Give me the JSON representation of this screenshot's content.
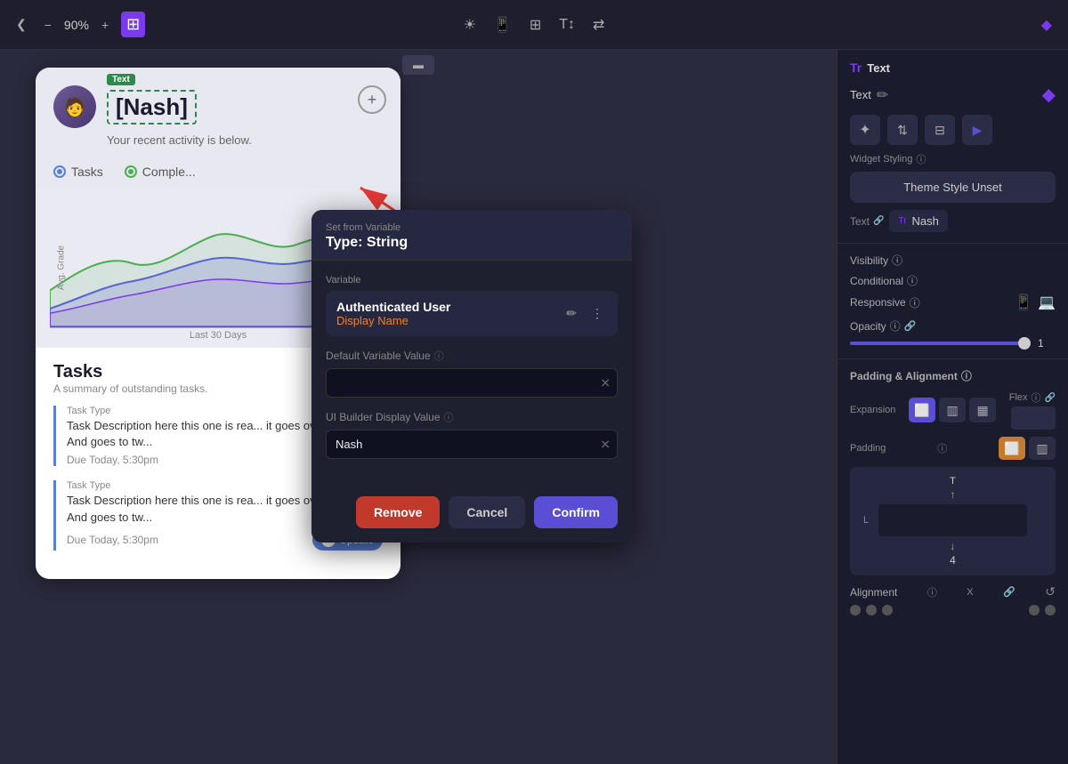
{
  "toolbar": {
    "zoom": "90%",
    "plus_label": "+",
    "minus_label": "−",
    "collapse_label": "❮",
    "icons": [
      "☀",
      "□",
      "⊞",
      "T↕",
      "⇄"
    ],
    "small_bar_icon": "▬"
  },
  "preview": {
    "text_badge": "Text",
    "user_name": "[Nash]",
    "user_subtitle": "Your recent activity is below.",
    "add_btn": "+",
    "tabs": [
      {
        "label": "Tasks",
        "active": true,
        "color": "blue"
      },
      {
        "label": "Comple...",
        "active": false,
        "color": "green"
      }
    ],
    "chart": {
      "x_label": "Last 30 Days",
      "y_label": "Avg. Grade"
    },
    "tasks": {
      "title": "Tasks",
      "subtitle": "A summary of outstanding tasks.",
      "items": [
        {
          "type": "Task Type",
          "desc": "Task Description here this one is rea... it goes over maybe? And goes to tw...",
          "due": "Due Today, 5:30pm"
        },
        {
          "type": "Task Type",
          "desc": "Task Description here this one is rea... it goes over maybe? And goes to tw...",
          "due": "Due Today, 5:30pm",
          "has_update": true,
          "update_count": "1",
          "update_label": "Update"
        }
      ]
    }
  },
  "modal": {
    "header_label": "Set from Variable",
    "type_label": "Type: String",
    "variable_section": "Variable",
    "var_title": "Authenticated User",
    "var_subtitle": "Display Name",
    "default_value_label": "Default Variable Value",
    "default_value_placeholder": "",
    "ui_builder_label": "UI Builder Display Value",
    "ui_builder_value": "Nash",
    "remove_btn": "Remove",
    "cancel_btn": "Cancel",
    "confirm_btn": "Confirm"
  },
  "right_panel": {
    "title": "Text",
    "edit_label": "Text",
    "edit_icon": "✏",
    "widget_styling_label": "Widget Styling",
    "info_icon": "ⓘ",
    "theme_style_btn": "Theme Style Unset",
    "text_section_label": "Text",
    "text_value": "Nash",
    "visibility_label": "Visibility",
    "conditional_label": "Conditional",
    "responsive_label": "Responsive",
    "opacity_label": "Opacity",
    "opacity_value": "1",
    "padding_label": "Padding & Alignment",
    "expansion_label": "Expansion",
    "flex_label": "Flex",
    "padding_inner_label": "Padding",
    "alignment_label": "Alignment",
    "x_label": "X",
    "padding_top": "T",
    "padding_left": "L",
    "padding_value_num": "4"
  }
}
